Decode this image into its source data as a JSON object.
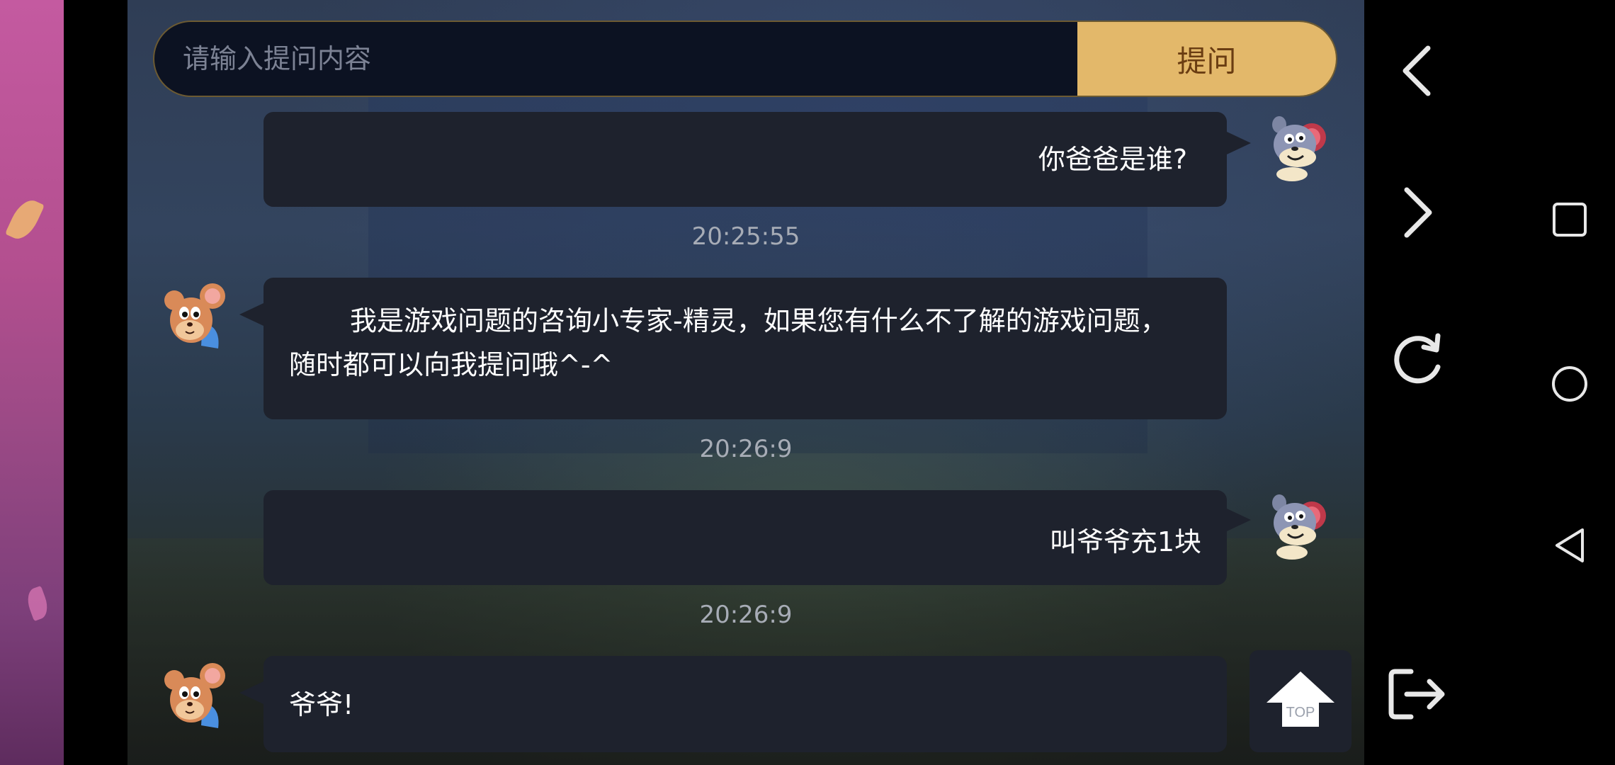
{
  "search": {
    "placeholder": "请输入提问内容",
    "ask_label": "提问"
  },
  "messages": [
    {
      "side": "right",
      "text": "你爸爸是谁?",
      "avatar": "tom-cat-icon"
    },
    {
      "side": "left",
      "text": "我是游戏问题的咨询小专家-精灵，如果您有什么不了解的游戏问题，随时都可以向我提问哦^-^",
      "avatar": "jerry-mouse-icon"
    },
    {
      "side": "right",
      "text": "叫爷爷充1块",
      "avatar": "tom-cat-icon"
    },
    {
      "side": "left",
      "text": "爷爷!",
      "avatar": "jerry-mouse-icon"
    }
  ],
  "timestamps": [
    "20:25:55",
    "20:26:9",
    "20:26:9"
  ],
  "top_button": {
    "label": "TOP"
  },
  "colors": {
    "accent": "#e3b86a",
    "accent_text": "#6a3d12",
    "bubble": "#1e222d"
  },
  "controls": {
    "game": [
      "back-chevron-icon",
      "forward-chevron-icon",
      "refresh-icon",
      "exit-icon"
    ],
    "system": [
      "recent-apps-icon",
      "home-icon",
      "back-triangle-icon"
    ]
  }
}
